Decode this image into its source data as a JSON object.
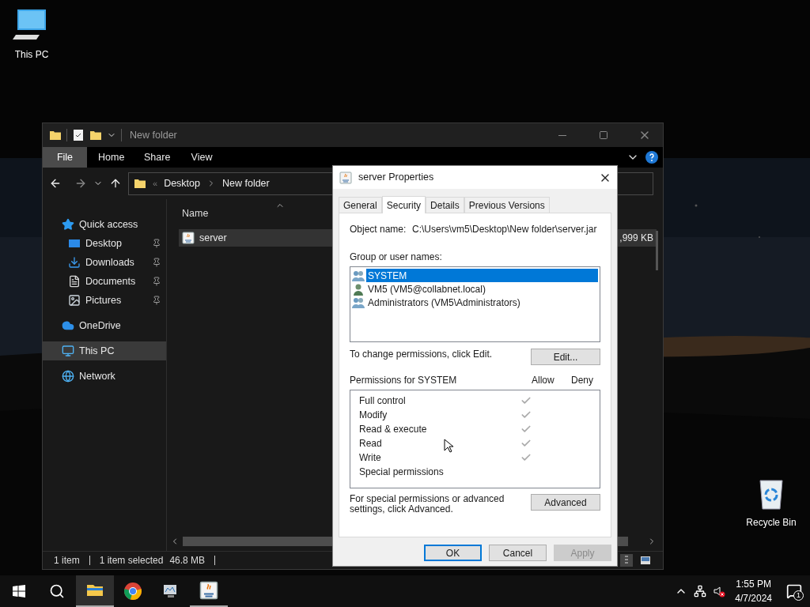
{
  "desktop_icons": [
    {
      "label": "This PC",
      "kind": "pc"
    },
    {
      "label": "Recycle Bin",
      "kind": "bin"
    }
  ],
  "explorer": {
    "title": "New folder",
    "ribbon_tabs": [
      {
        "label": "File",
        "selected": true
      },
      {
        "label": "Home",
        "selected": false
      },
      {
        "label": "Share",
        "selected": false
      },
      {
        "label": "View",
        "selected": false
      }
    ],
    "overflow": "«",
    "breadcrumb": [
      "Desktop",
      "New folder"
    ],
    "nav_items": [
      {
        "label": "Quick access",
        "kind": "star",
        "selected": false,
        "children": [
          {
            "label": "Desktop",
            "kind": "desktop",
            "pinned": true,
            "selected": false
          },
          {
            "label": "Downloads",
            "kind": "download",
            "pinned": true,
            "selected": false
          },
          {
            "label": "Documents",
            "kind": "document",
            "pinned": true,
            "selected": false
          },
          {
            "label": "Pictures",
            "kind": "pictures",
            "pinned": true,
            "selected": false
          }
        ]
      },
      {
        "label": "OneDrive",
        "kind": "cloud",
        "selected": false
      },
      {
        "label": "This PC",
        "kind": "pc",
        "selected": true
      },
      {
        "label": "Network",
        "kind": "network",
        "selected": false
      }
    ],
    "column": "Name",
    "files": [
      {
        "name": "server",
        "size": ",999 KB",
        "selected": true
      }
    ],
    "status": [
      "1 item",
      "1 item selected",
      "46.8 MB"
    ]
  },
  "dialog": {
    "title": "server Properties",
    "tabs": [
      {
        "label": "General",
        "selected": false
      },
      {
        "label": "Security",
        "selected": true
      },
      {
        "label": "Details",
        "selected": false
      },
      {
        "label": "Previous Versions",
        "selected": false
      }
    ],
    "object_label": "Object name:",
    "object_name": "C:\\Users\\vm5\\Desktop\\New folder\\server.jar",
    "group_label": "Group or user names:",
    "users": [
      {
        "name": "SYSTEM",
        "kind": "group",
        "selected": true
      },
      {
        "name": "VM5 (VM5@collabnet.local)",
        "kind": "user",
        "selected": false
      },
      {
        "name": "Administrators (VM5\\Administrators)",
        "kind": "group",
        "selected": false
      }
    ],
    "change_hint": "To change permissions, click Edit.",
    "edit_button": "Edit...",
    "permissions_label": "Permissions for SYSTEM",
    "allow_label": "Allow",
    "deny_label": "Deny",
    "permissions": [
      {
        "name": "Full control",
        "allow": true,
        "deny": false
      },
      {
        "name": "Modify",
        "allow": true,
        "deny": false
      },
      {
        "name": "Read & execute",
        "allow": true,
        "deny": false
      },
      {
        "name": "Read",
        "allow": true,
        "deny": false
      },
      {
        "name": "Write",
        "allow": true,
        "deny": false
      },
      {
        "name": "Special permissions",
        "allow": false,
        "deny": false
      }
    ],
    "advanced_hint": "For special permissions or advanced settings, click Advanced.",
    "advanced_button": "Advanced",
    "buttons": [
      {
        "label": "OK",
        "default": true,
        "disabled": false
      },
      {
        "label": "Cancel",
        "default": false,
        "disabled": false
      },
      {
        "label": "Apply",
        "default": false,
        "disabled": true
      }
    ]
  },
  "taskbar": {
    "apps": [
      {
        "kind": "explorer",
        "active": true
      },
      {
        "kind": "chrome",
        "active": false
      },
      {
        "kind": "monitor",
        "active": false
      },
      {
        "kind": "java",
        "active": true
      }
    ],
    "time": "1:55 PM",
    "date": "4/7/2024",
    "notifications": "1"
  }
}
